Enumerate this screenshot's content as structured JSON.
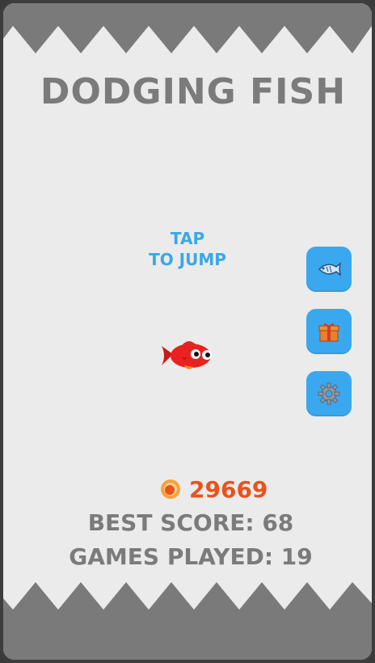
{
  "game": {
    "title": "DODGING FISH",
    "instruction_line1": "TAP",
    "instruction_line2": "TO JUMP",
    "coins": "29669",
    "best_score": "BEST SCORE: 68",
    "games_played": "GAMES PLAYED: 19"
  },
  "side_buttons": [
    {
      "icon": "fish-icon"
    },
    {
      "icon": "gift-icon"
    },
    {
      "icon": "gear-icon"
    }
  ],
  "colors": {
    "background": "#ebebeb",
    "spikes": "#7a7a7a",
    "frame": "#3d3d3d",
    "title": "#7b7b7b",
    "instruction": "#3aa8e8",
    "button": "#3aa8ee",
    "coins_text": "#e8531c",
    "fish": "#e8231f"
  }
}
